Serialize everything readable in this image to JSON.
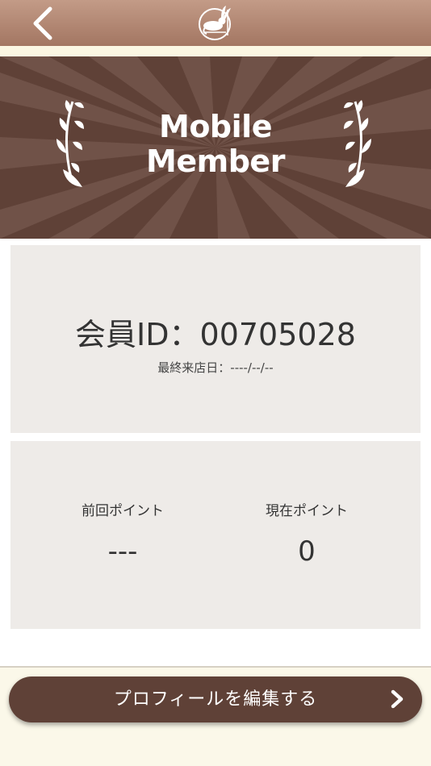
{
  "header": {
    "back_icon": "chevron-left-icon",
    "logo_icon": "rabbit-logo-icon",
    "bar_color": "#a97c68"
  },
  "banner": {
    "title_line1": "Mobile",
    "title_line2": "Member",
    "background_color": "#5f4137",
    "decoration_icon": "laurel-branch-icon"
  },
  "member": {
    "id_text": "会員ID：00705028",
    "last_visit_text": "最終来店日：----/--/--"
  },
  "points": {
    "previous_label": "前回ポイント",
    "previous_value": "---",
    "current_label": "現在ポイント",
    "current_value": "0"
  },
  "actions": {
    "edit_profile_label": "プロフィールを編集する",
    "edit_profile_icon": "chevron-right-icon",
    "button_color": "#5f4137"
  }
}
